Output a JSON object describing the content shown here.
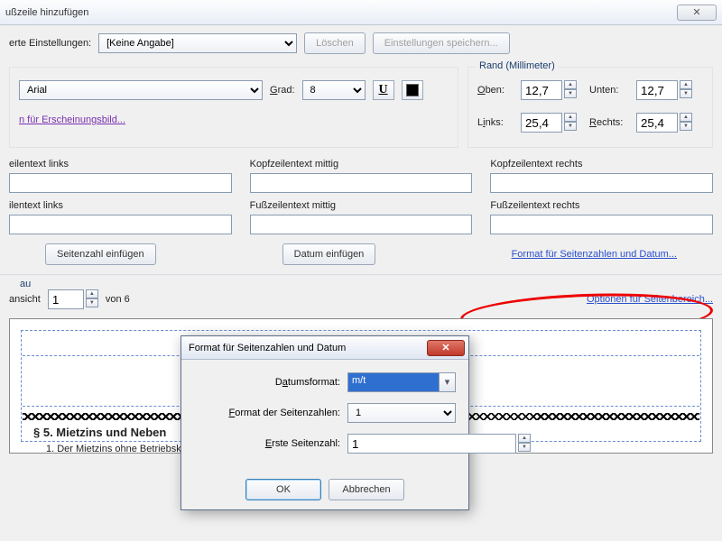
{
  "window": {
    "title": "ußzeile hinzufügen",
    "close_symbol": "✕"
  },
  "toolbar": {
    "saved_settings_label": "erte Einstellungen:",
    "saved_settings_value": "[Keine Angabe]",
    "delete_label": "Löschen",
    "save_settings_label": "Einstellungen speichern..."
  },
  "font": {
    "family": "Arial",
    "size_label": "Grad:",
    "size": "8",
    "underline_symbol": "U",
    "color_hex": "#000000"
  },
  "appearance_link": "n für Erscheinungsbild...",
  "margins": {
    "group_label": "Rand (Millimeter)",
    "top_label": "Oben:",
    "top": "12,7",
    "bottom_label": "Unten:",
    "bottom": "12,7",
    "left_label": "Links:",
    "left": "25,4",
    "right_label": "Rechts:",
    "right": "25,4"
  },
  "fields": {
    "header_left": "eilentext links",
    "header_mid": "Kopfzeilentext mittig",
    "header_right": "Kopfzeilentext rechts",
    "footer_left": "ilentext links",
    "footer_mid": "Fußzeilentext mittig",
    "footer_right": "Fußzeilentext rechts"
  },
  "buttons": {
    "insert_page": "Seitenzahl einfügen",
    "insert_date": "Datum einfügen",
    "format_link": "Format für Seitenzahlen und Datum..."
  },
  "preview": {
    "group_label": "au",
    "view_label": "ansicht",
    "page": "1",
    "of_label": "von 6",
    "range_link": "Optionen für Seitenbereich..."
  },
  "doc": {
    "heading": "§ 5.   Mietzins und Neben",
    "line1": "1.    Der Mietzins ohne Betriebskosten beträgt monatlich"
  },
  "dialog": {
    "title": "Format für Seitenzahlen und Datum",
    "date_label": "Datumsformat:",
    "date_value": "m/t",
    "page_format_label": "Format der Seitenzahlen:",
    "page_format_value": "1",
    "first_page_label": "Erste Seitenzahl:",
    "first_page_value": "1",
    "ok": "OK",
    "cancel": "Abbrechen"
  }
}
